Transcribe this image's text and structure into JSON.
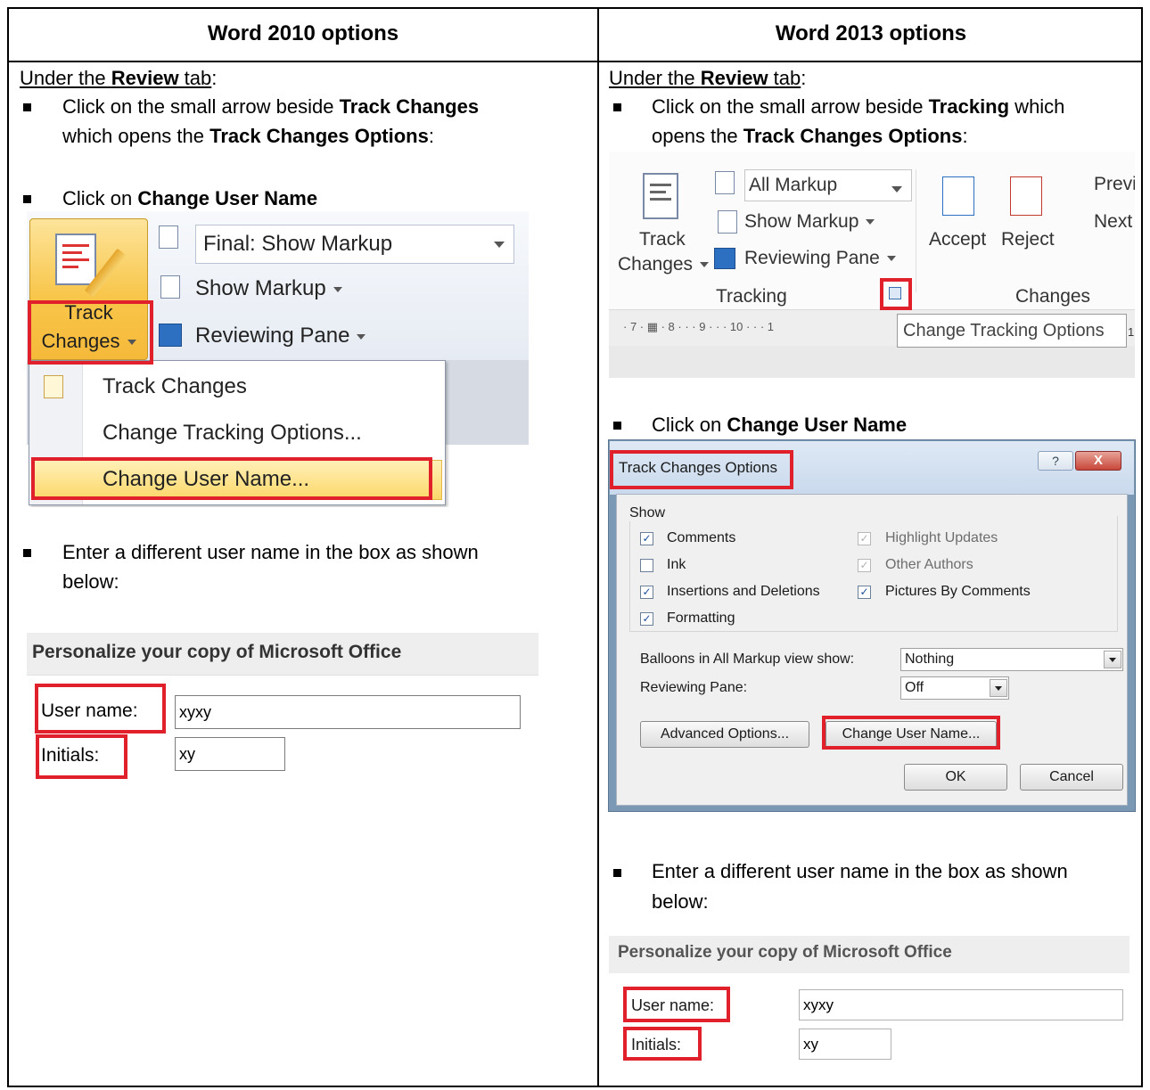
{
  "headers": {
    "left": "Word 2010 options",
    "right": "Word 2013 options"
  },
  "left": {
    "under_pre": "Under the ",
    "under_bold": "Review",
    "under_post": " tab",
    "colon": ":",
    "b1_pre": "Click on the small arrow beside ",
    "b1_bold1": "Track Changes",
    "b1_line2_pre": "which opens the ",
    "b1_bold2": "Track Changes Options",
    "b1_post": ":",
    "b2_pre": "Click on ",
    "b2_bold": "Change User Name",
    "b3_line1": "Enter a different user name in the box as shown",
    "b3_line2": "below:"
  },
  "right": {
    "under_pre": "Under the ",
    "under_bold": "Review",
    "under_post": " tab",
    "colon": ":",
    "b1_pre": "Click on the small arrow beside ",
    "b1_bold1": "Tracking",
    "b1_post1": " which",
    "b1_line2_pre": "opens the ",
    "b1_bold2": "Track Changes Options",
    "b1_post": ":",
    "b2_pre": "Click on ",
    "b2_bold": "Change User Name",
    "b3_line1": "Enter a different user name in the box as shown",
    "b3_line2": "below:"
  },
  "w2010": {
    "combo": "Final: Show Markup",
    "show_markup": "Show Markup",
    "reviewing_pane": "Reviewing Pane",
    "track": "Track",
    "changes": "Changes",
    "menu": [
      "Track Changes",
      "Change Tracking Options...",
      "Change User Name..."
    ]
  },
  "pers2010": {
    "heading": "Personalize your copy of Microsoft Office",
    "user_label": "User name:",
    "user_value": "xyxy",
    "initials_label": "Initials:",
    "initials_value": "xy"
  },
  "w2013": {
    "combo": "All Markup",
    "show_markup": "Show Markup",
    "reviewing_pane": "Reviewing Pane",
    "track": "Track",
    "changes": "Changes",
    "tracking_group": "Tracking",
    "accept": "Accept",
    "reject": "Reject",
    "previous": "Previ",
    "next": "Next",
    "changes_group": "Changes",
    "ruler": "· 7 · ▦ · 8 · · · 9 · · · 10 · · · 1",
    "tooltip": "Change Tracking Options",
    "tooltip_tail": "1!"
  },
  "dialog": {
    "title": "Track Changes Options",
    "help": "?",
    "close": "X",
    "show_group": "Show",
    "checks_left": [
      {
        "label": "Comments",
        "checked": "✓"
      },
      {
        "label": "Ink",
        "checked": ""
      },
      {
        "label": "Insertions and Deletions",
        "checked": "✓"
      },
      {
        "label": "Formatting",
        "checked": "✓"
      }
    ],
    "checks_right": [
      {
        "label": "Highlight Updates",
        "checked": "✓"
      },
      {
        "label": "Other Authors",
        "checked": "✓"
      },
      {
        "label": "Pictures By Comments",
        "checked": "✓"
      }
    ],
    "balloons_label": "Balloons in All Markup view show:",
    "balloons_value": "Nothing",
    "pane_label": "Reviewing Pane:",
    "pane_value": "Off",
    "advanced_button": "Advanced Options...",
    "change_user_button": "Change User Name...",
    "ok": "OK",
    "cancel": "Cancel"
  },
  "pers2013": {
    "heading": "Personalize your copy of Microsoft Office",
    "user_label": "User name:",
    "user_value": "xyxy",
    "initials_label": "Initials:",
    "initials_value": "xy"
  },
  "colors": {
    "highlight_red": "#e0202a",
    "office_gold": "#f8c64a",
    "dialog_blue": "#7b99b5"
  }
}
